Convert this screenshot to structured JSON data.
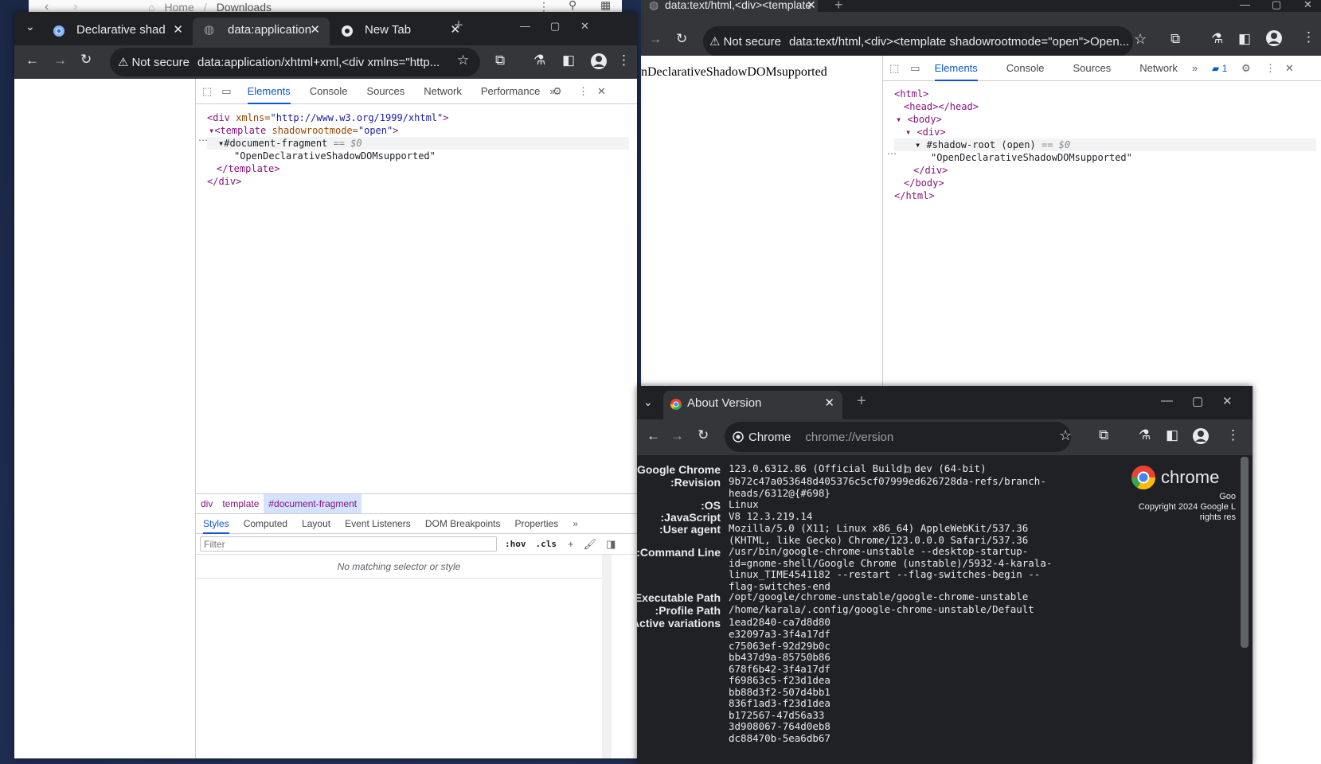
{
  "files": {
    "crumbs": [
      "Home",
      "Downloads"
    ]
  },
  "right_window": {
    "tab_title": "data:text/html,<div><template",
    "not_secure": "Not secure",
    "url": "data:text/html,<div><template shadowrootmode=\"open\">Open...",
    "page_text": "nDeclarativeShadowDOMsupported",
    "devtools_tabs": [
      "Elements",
      "Console",
      "Sources",
      "Network"
    ],
    "issues_count": "1",
    "tree": {
      "l1": "<html>",
      "l2": "<head></head>",
      "l3": "<body>",
      "l4": "<div>",
      "l5": "#shadow-root (open)",
      "l5b": "== $0",
      "l6": "\"OpenDeclarativeShadowDOMsupported\"",
      "l7": "</div>",
      "l8": "</body>",
      "l9": "</html>"
    }
  },
  "left_window": {
    "tabs": [
      {
        "label": "Declarative shad"
      },
      {
        "label": "data:application"
      },
      {
        "label": "New Tab"
      }
    ],
    "not_secure": "Not secure",
    "url": "data:application/xhtml+xml,<div xmlns=\"http...",
    "devtools_tabs": [
      "Elements",
      "Console",
      "Sources",
      "Network",
      "Performance"
    ],
    "tree": {
      "div_open": "<div",
      "div_attr": "xmlns=",
      "div_val": "\"http://www.w3.org/1999/xhtml\"",
      "tpl_open": "<template",
      "tpl_attr": "shadowrootmode=",
      "tpl_val": "\"open\"",
      "frag": "#document-fragment",
      "frag_b": "== $0",
      "text": "\"OpenDeclarativeShadowDOMsupported\"",
      "tpl_close": "</template>",
      "div_close": "</div>"
    },
    "crumbs": [
      "div",
      "template",
      "#document-fragment"
    ],
    "subtabs": [
      "Styles",
      "Computed",
      "Layout",
      "Event Listeners",
      "DOM Breakpoints",
      "Properties"
    ],
    "filter_placeholder": "Filter",
    "hov": ":hov",
    "cls": ".cls",
    "no_match": "No matching selector or style"
  },
  "about_window": {
    "tab_title": "About Version",
    "omni_label": "Chrome",
    "url": "chrome://version",
    "logo_text": "chrome",
    "copyright_1": "Goo",
    "copyright_2": "Copyright 2024 Google L",
    "copyright_3": "rights res",
    "rows": [
      {
        "k": "Google Chrome:",
        "v": "123.0.6312.86 (Official Build) dev (64-bit)"
      },
      {
        "k": "Revision:",
        "v": "9b72c47a053648d405376c5cf07999ed626728da-refs/branch-heads/6312@{#698}"
      },
      {
        "k": "OS:",
        "v": "Linux"
      },
      {
        "k": "JavaScript:",
        "v": "V8 12.3.219.14"
      },
      {
        "k": "User agent:",
        "v": "Mozilla/5.0 (X11; Linux x86_64) AppleWebKit/537.36 (KHTML, like Gecko) Chrome/123.0.0.0 Safari/537.36"
      },
      {
        "k": "Command Line:",
        "v": "/usr/bin/google-chrome-unstable --desktop-startup-id=gnome-shell/Google Chrome (unstable)/5932-4-karala-linux_TIME4541182 --restart --flag-switches-begin --flag-switches-end"
      },
      {
        "k": "Executable Path:",
        "v": "/opt/google/chrome-unstable/google-chrome-unstable"
      },
      {
        "k": "Profile Path:",
        "v": "/home/karala/.config/google-chrome-unstable/Default"
      },
      {
        "k": "Active variations:",
        "v": "1ead2840-ca7d8d80"
      }
    ],
    "variations": [
      "e32097a3-3f4a17df",
      "c75063ef-92d29b0c",
      "bb437d9a-85750b86",
      "678f6b42-3f4a17df",
      "f69863c5-f23d1dea",
      "bb88d3f2-507d4bb1",
      "836f1ad3-f23d1dea",
      "b172567-47d56a33",
      "3d908067-764d0eb8",
      "dc88470b-5ea6db67"
    ]
  }
}
